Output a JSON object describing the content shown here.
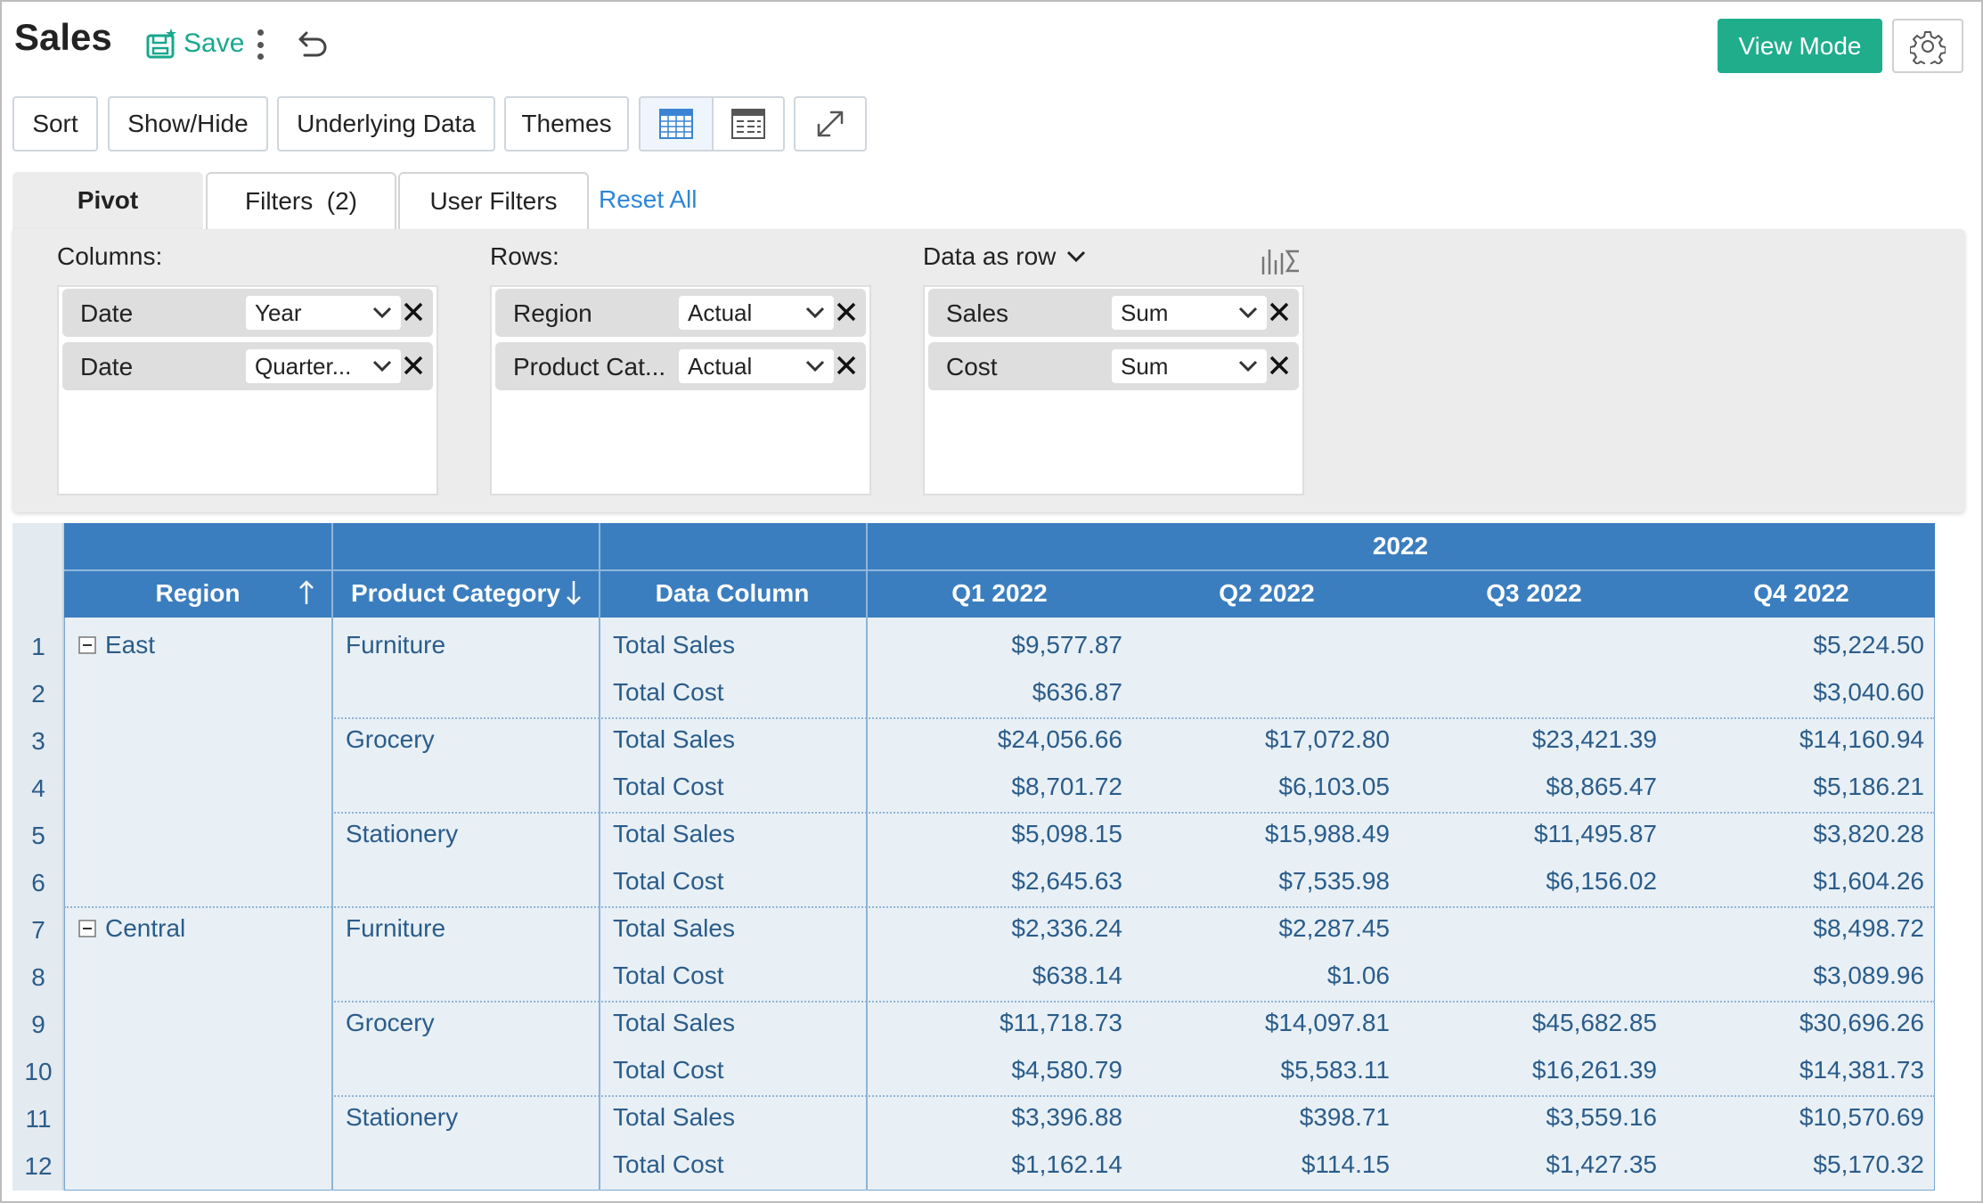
{
  "header": {
    "title": "Sales",
    "save_label": "Save",
    "view_mode_label": "View Mode"
  },
  "toolbar": {
    "sort": "Sort",
    "show_hide": "Show/Hide",
    "underlying_data": "Underlying Data",
    "themes": "Themes"
  },
  "tabs": {
    "pivot": "Pivot",
    "filters": "Filters  (2)",
    "user_filters": "User Filters",
    "reset_all": "Reset All"
  },
  "pivot": {
    "columns_label": "Columns:",
    "rows_label": "Rows:",
    "data_as_row_label": "Data as row",
    "columns": [
      {
        "field": "Date",
        "agg": "Year"
      },
      {
        "field": "Date",
        "agg": "Quarter..."
      }
    ],
    "rows": [
      {
        "field": "Region",
        "agg": "Actual"
      },
      {
        "field": "Product Cat...",
        "agg": "Actual"
      }
    ],
    "data": [
      {
        "field": "Sales",
        "agg": "Sum"
      },
      {
        "field": "Cost",
        "agg": "Sum"
      }
    ]
  },
  "grid": {
    "year_header": "2022",
    "col_headers": {
      "region": "Region",
      "product_category": "Product Category",
      "data_column": "Data Column"
    },
    "quarters": [
      "Q1 2022",
      "Q2 2022",
      "Q3 2022",
      "Q4 2022"
    ],
    "row_numbers": [
      "1",
      "2",
      "3",
      "4",
      "5",
      "6",
      "7",
      "8",
      "9",
      "10",
      "11",
      "12"
    ],
    "regions": [
      "East",
      "Central"
    ],
    "categories": [
      "Furniture",
      "Grocery",
      "Stationery",
      "Furniture",
      "Grocery",
      "Stationery"
    ],
    "measures": [
      "Total Sales",
      "Total Cost"
    ],
    "values": [
      [
        "$9,577.87",
        "",
        "",
        "$5,224.50"
      ],
      [
        "$636.87",
        "",
        "",
        "$3,040.60"
      ],
      [
        "$24,056.66",
        "$17,072.80",
        "$23,421.39",
        "$14,160.94"
      ],
      [
        "$8,701.72",
        "$6,103.05",
        "$8,865.47",
        "$5,186.21"
      ],
      [
        "$5,098.15",
        "$15,988.49",
        "$11,495.87",
        "$3,820.28"
      ],
      [
        "$2,645.63",
        "$7,535.98",
        "$6,156.02",
        "$1,604.26"
      ],
      [
        "$2,336.24",
        "$2,287.45",
        "",
        "$8,498.72"
      ],
      [
        "$638.14",
        "$1.06",
        "",
        "$3,089.96"
      ],
      [
        "$11,718.73",
        "$14,097.81",
        "$45,682.85",
        "$30,696.26"
      ],
      [
        "$4,580.79",
        "$5,583.11",
        "$16,261.39",
        "$14,381.73"
      ],
      [
        "$3,396.88",
        "$398.71",
        "$3,559.16",
        "$10,570.69"
      ],
      [
        "$1,162.14",
        "$114.15",
        "$1,427.35",
        "$5,170.32"
      ]
    ]
  },
  "colors": {
    "accent_green": "#1fad8c",
    "header_blue": "#3b7ebf",
    "link_blue": "#2f86d8",
    "cell_bg": "#e8f0f6"
  }
}
